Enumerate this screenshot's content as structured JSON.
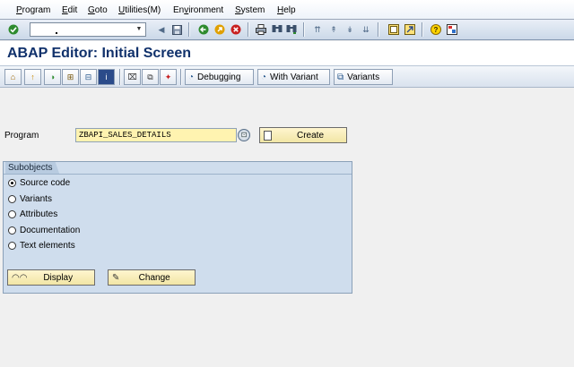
{
  "menubar": {
    "items": [
      {
        "label": "Program",
        "underline": "P"
      },
      {
        "label": "Edit",
        "underline": "E"
      },
      {
        "label": "Goto",
        "underline": "G"
      },
      {
        "label": "Utilities(M)",
        "underline": "U"
      },
      {
        "label": "Environment",
        "underline": "v"
      },
      {
        "label": "System",
        "underline": "S"
      },
      {
        "label": "Help",
        "underline": "H"
      }
    ]
  },
  "system_toolbar": {
    "command_field": {
      "value": ""
    },
    "icons": [
      "enter-icon",
      "back-icon",
      "save-icon",
      "back-arrow-icon",
      "exit-icon",
      "cancel-icon",
      "print-icon",
      "find-icon",
      "find-next-icon",
      "first-page-icon",
      "prev-page-icon",
      "next-page-icon",
      "last-page-icon",
      "create-session-icon",
      "shortcut-icon",
      "help-icon",
      "customize-layout-icon"
    ],
    "colors": {
      "accent": "#10316b",
      "enter": "#2e8b2e",
      "cancel": "#c82020"
    }
  },
  "title": "ABAP Editor: Initial Screen",
  "app_toolbar": {
    "debugging_label": "Debugging",
    "with_variant_label": "With Variant",
    "variants_label": "Variants"
  },
  "program": {
    "label": "Program",
    "value": "ZBAPI_SALES_DETAILS",
    "create_label": "Create"
  },
  "subobjects": {
    "title": "Subobjects",
    "options": [
      {
        "label": "Source code",
        "selected": true
      },
      {
        "label": "Variants",
        "selected": false
      },
      {
        "label": "Attributes",
        "selected": false
      },
      {
        "label": "Documentation",
        "selected": false
      },
      {
        "label": "Text elements",
        "selected": false
      }
    ],
    "display_label": "Display",
    "change_label": "Change"
  }
}
